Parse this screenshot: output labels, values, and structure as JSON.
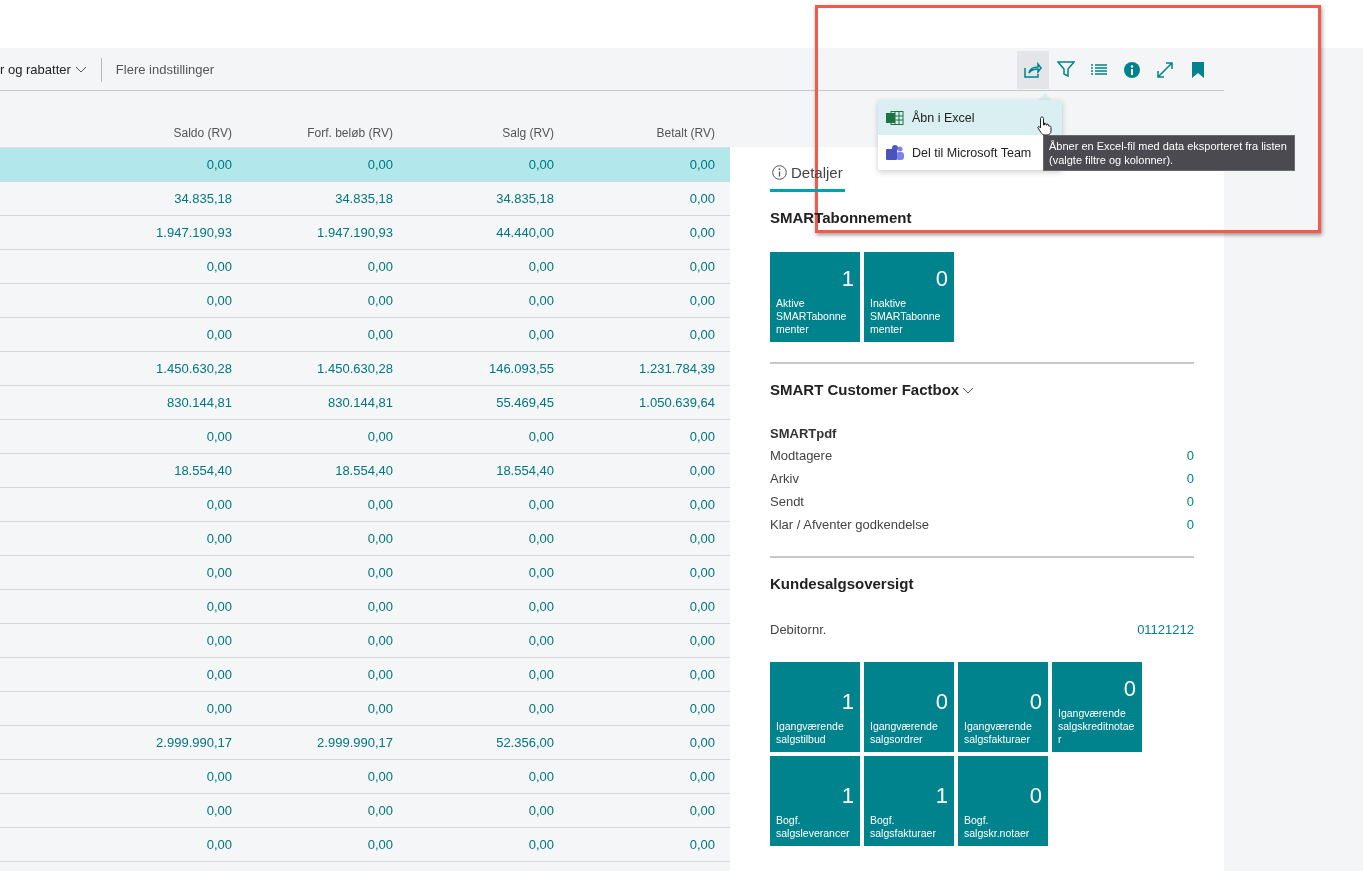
{
  "toolbar": {
    "actions": [
      {
        "label": "r og rabatter",
        "dropdown": true
      },
      {
        "label": "Flere indstillinger",
        "dropdown": false
      }
    ],
    "icons": [
      {
        "kind": "share",
        "selected": true
      },
      {
        "kind": "filter",
        "selected": false
      },
      {
        "kind": "list",
        "selected": false
      },
      {
        "kind": "info",
        "selected": false
      },
      {
        "kind": "expand",
        "selected": false
      },
      {
        "kind": "bookmark",
        "selected": false
      }
    ]
  },
  "share_menu": {
    "items": [
      {
        "kind": "excel",
        "label": "Åbn i Excel",
        "selected": true
      },
      {
        "kind": "teams",
        "label": "Del til Microsoft Team",
        "selected": false
      }
    ],
    "tooltip": "Åbner en Excel-fil med data eksporteret fra listen (valgte filtre og kolonner)."
  },
  "table": {
    "columns": [
      "Saldo (RV)",
      "Forf. beløb (RV)",
      "Salg (RV)",
      "Betalt (RV)"
    ],
    "rows": [
      {
        "selected": true,
        "cells": [
          "0,00",
          "0,00",
          "0,00",
          "0,00"
        ]
      },
      {
        "selected": false,
        "cells": [
          "34.835,18",
          "34.835,18",
          "34.835,18",
          "0,00"
        ]
      },
      {
        "selected": false,
        "cells": [
          "1.947.190,93",
          "1.947.190,93",
          "44.440,00",
          "0,00"
        ]
      },
      {
        "selected": false,
        "cells": [
          "0,00",
          "0,00",
          "0,00",
          "0,00"
        ]
      },
      {
        "selected": false,
        "cells": [
          "0,00",
          "0,00",
          "0,00",
          "0,00"
        ]
      },
      {
        "selected": false,
        "cells": [
          "0,00",
          "0,00",
          "0,00",
          "0,00"
        ]
      },
      {
        "selected": false,
        "cells": [
          "1.450.630,28",
          "1.450.630,28",
          "146.093,55",
          "1.231.784,39"
        ]
      },
      {
        "selected": false,
        "cells": [
          "830.144,81",
          "830.144,81",
          "55.469,45",
          "1.050.639,64"
        ]
      },
      {
        "selected": false,
        "cells": [
          "0,00",
          "0,00",
          "0,00",
          "0,00"
        ]
      },
      {
        "selected": false,
        "cells": [
          "18.554,40",
          "18.554,40",
          "18.554,40",
          "0,00"
        ]
      },
      {
        "selected": false,
        "cells": [
          "0,00",
          "0,00",
          "0,00",
          "0,00"
        ]
      },
      {
        "selected": false,
        "cells": [
          "0,00",
          "0,00",
          "0,00",
          "0,00"
        ]
      },
      {
        "selected": false,
        "cells": [
          "0,00",
          "0,00",
          "0,00",
          "0,00"
        ]
      },
      {
        "selected": false,
        "cells": [
          "0,00",
          "0,00",
          "0,00",
          "0,00"
        ]
      },
      {
        "selected": false,
        "cells": [
          "0,00",
          "0,00",
          "0,00",
          "0,00"
        ]
      },
      {
        "selected": false,
        "cells": [
          "0,00",
          "0,00",
          "0,00",
          "0,00"
        ]
      },
      {
        "selected": false,
        "cells": [
          "0,00",
          "0,00",
          "0,00",
          "0,00"
        ]
      },
      {
        "selected": false,
        "cells": [
          "2.999.990,17",
          "2.999.990,17",
          "52.356,00",
          "0,00"
        ]
      },
      {
        "selected": false,
        "cells": [
          "0,00",
          "0,00",
          "0,00",
          "0,00"
        ]
      },
      {
        "selected": false,
        "cells": [
          "0,00",
          "0,00",
          "0,00",
          "0,00"
        ]
      },
      {
        "selected": false,
        "cells": [
          "0,00",
          "0,00",
          "0,00",
          "0,00"
        ]
      }
    ]
  },
  "factbox": {
    "tabs": [
      {
        "label": "Detaljer",
        "selected": true
      }
    ],
    "sections": [
      {
        "title": "SMARTabonnement",
        "expandable": false,
        "tiles": [
          {
            "value": "1",
            "label": "Aktive SMARTabonnementer"
          },
          {
            "value": "0",
            "label": "Inaktive SMARTabonnementer"
          }
        ]
      },
      {
        "title": "SMART Customer Factbox",
        "expandable": true,
        "group_title": "SMARTpdf",
        "fields": [
          {
            "label": "Modtagere",
            "value": "0"
          },
          {
            "label": "Arkiv",
            "value": "0"
          },
          {
            "label": "Sendt",
            "value": "0"
          },
          {
            "label": "Klar / Afventer godkendelse",
            "value": "0"
          }
        ]
      },
      {
        "title": "Kundesalgsoversigt",
        "expandable": false,
        "fields": [
          {
            "label": "Debitornr.",
            "value": "01121212"
          }
        ],
        "tiles": [
          {
            "value": "1",
            "label": "Igangværende salgstilbud"
          },
          {
            "value": "0",
            "label": "Igangværende salgsordrer"
          },
          {
            "value": "0",
            "label": "Igangværende salgsfakturaer"
          },
          {
            "value": "0",
            "label": "Igangværende salgskreditnotaer"
          },
          {
            "value": "1",
            "label": "Bogf. salgsleverancer"
          },
          {
            "value": "1",
            "label": "Bogf. salgsfakturaer"
          },
          {
            "value": "0",
            "label": "Bogf. salgskr.notaer"
          }
        ]
      }
    ]
  }
}
